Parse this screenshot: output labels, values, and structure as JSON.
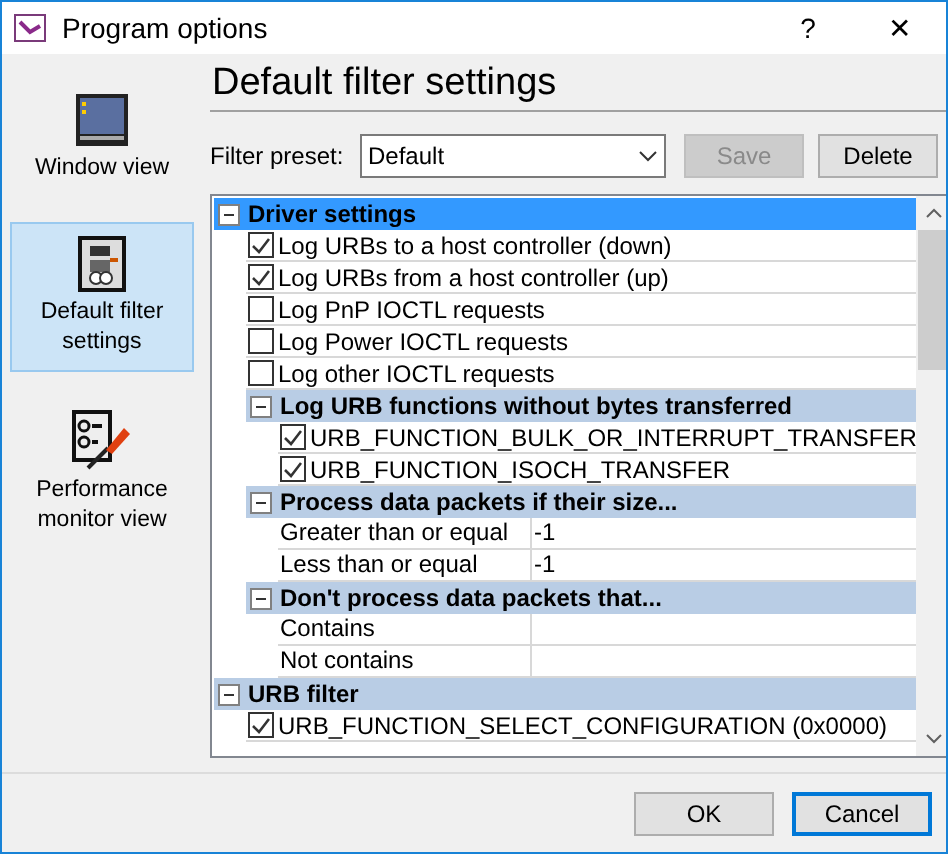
{
  "window": {
    "title": "Program options",
    "help": "?",
    "close": "✕"
  },
  "sidebar": {
    "items": [
      {
        "label": "Window view",
        "selected": false,
        "kind": "window"
      },
      {
        "label": "Default filter settings",
        "selected": true,
        "kind": "filter"
      },
      {
        "label": "Performance monitor view",
        "selected": false,
        "kind": "monitor"
      }
    ]
  },
  "heading": "Default filter settings",
  "filter_preset": {
    "label": "Filter preset:",
    "value": "Default"
  },
  "preset_buttons": [
    {
      "label": "Save",
      "disabled": true
    },
    {
      "label": "Delete",
      "disabled": false
    }
  ],
  "tree": [
    {
      "kind": "group",
      "label": "Driver settings",
      "selected": true,
      "expanded": true,
      "children": [
        {
          "kind": "check",
          "label": "Log URBs to a host controller (down)",
          "checked": true
        },
        {
          "kind": "check",
          "label": "Log URBs from a host controller (up)",
          "checked": true
        },
        {
          "kind": "check",
          "label": "Log PnP IOCTL requests",
          "checked": false
        },
        {
          "kind": "check",
          "label": "Log Power IOCTL requests",
          "checked": false
        },
        {
          "kind": "check",
          "label": "Log other IOCTL requests",
          "checked": false
        },
        {
          "kind": "group",
          "label": "Log URB functions without bytes transferred",
          "selected": false,
          "expanded": true,
          "children": [
            {
              "kind": "check",
              "label": "URB_FUNCTION_BULK_OR_INTERRUPT_TRANSFER",
              "checked": true
            },
            {
              "kind": "check",
              "label": "URB_FUNCTION_ISOCH_TRANSFER",
              "checked": true
            }
          ]
        },
        {
          "kind": "group",
          "label": "Process data packets if their size...",
          "selected": false,
          "expanded": true,
          "children": [
            {
              "kind": "property",
              "label": "Greater than or equal",
              "value": "-1"
            },
            {
              "kind": "property",
              "label": "Less than or equal",
              "value": "-1"
            }
          ]
        },
        {
          "kind": "group",
          "label": "Don't process data packets that...",
          "selected": false,
          "expanded": true,
          "children": [
            {
              "kind": "property",
              "label": "Contains"
            },
            {
              "kind": "property",
              "label": "Not contains"
            }
          ]
        }
      ]
    },
    {
      "kind": "group",
      "label": "URB filter",
      "selected": false,
      "expanded": true,
      "children": [
        {
          "kind": "check",
          "label": "URB_FUNCTION_SELECT_CONFIGURATION (0x0000)",
          "checked": true
        }
      ]
    }
  ],
  "dialog_buttons": [
    {
      "label": "OK",
      "default": false
    },
    {
      "label": "Cancel",
      "default": true
    }
  ]
}
